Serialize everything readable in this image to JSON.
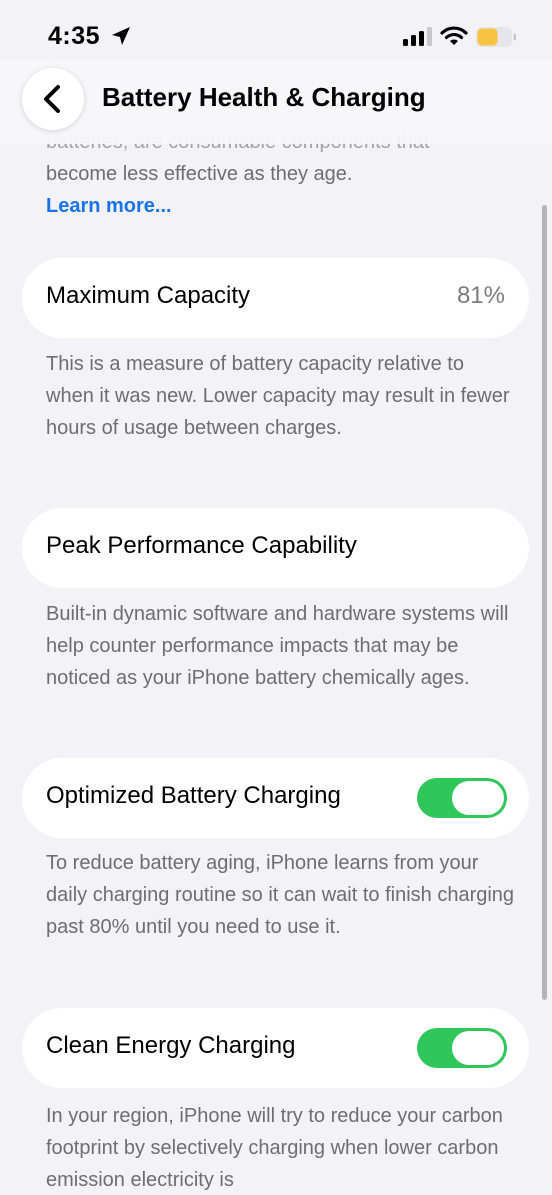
{
  "status_bar": {
    "time": "4:35",
    "icons": [
      "location-arrow-icon",
      "cellular-signal-icon",
      "wifi-icon",
      "battery-low-power-icon"
    ],
    "battery_color": "#f6c342"
  },
  "nav": {
    "title": "Battery Health & Charging",
    "back_icon": "chevron-left-icon"
  },
  "intro": {
    "partial_line": "batteries, are consumable components that",
    "line": "become less effective as they age.",
    "link": "Learn more..."
  },
  "sections": {
    "maximum_capacity": {
      "label": "Maximum Capacity",
      "value": "81%",
      "description": "This is a measure of battery capacity relative to when it was new. Lower capacity may result in fewer hours of usage between charges."
    },
    "peak_performance": {
      "label": "Peak Performance Capability",
      "description": "Built-in dynamic software and hardware systems will help counter performance impacts that may be noticed as your iPhone battery chemically ages."
    },
    "optimized_charging": {
      "label": "Optimized Battery Charging",
      "enabled": true,
      "description": "To reduce battery aging, iPhone learns from your daily charging routine so it can wait to finish charging past 80% until you need to use it."
    },
    "clean_energy": {
      "label": "Clean Energy Charging",
      "enabled": true,
      "description": "In your region, iPhone will try to reduce your carbon footprint by selectively charging when lower carbon emission electricity is"
    }
  },
  "colors": {
    "accent_link": "#1a73e8",
    "toggle_on": "#2fc65a",
    "background": "#f2f2f7"
  }
}
